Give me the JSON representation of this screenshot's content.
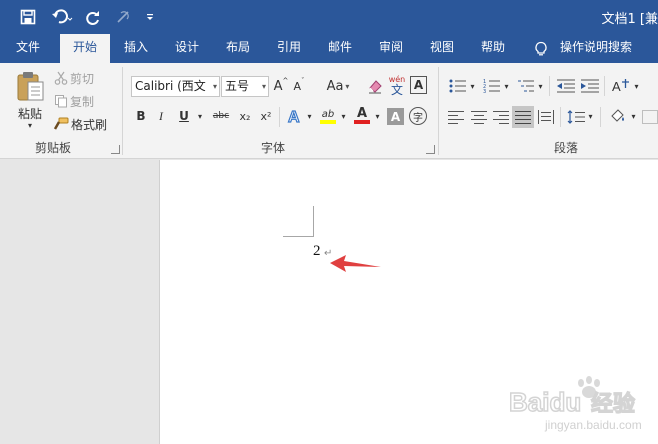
{
  "title_bar": {
    "doc_title": "文档1 [兼"
  },
  "tabs": [
    {
      "label": "文件"
    },
    {
      "label": "开始"
    },
    {
      "label": "插入"
    },
    {
      "label": "设计"
    },
    {
      "label": "布局"
    },
    {
      "label": "引用"
    },
    {
      "label": "邮件"
    },
    {
      "label": "审阅"
    },
    {
      "label": "视图"
    },
    {
      "label": "帮助"
    },
    {
      "label": "操作说明搜索"
    }
  ],
  "clipboard": {
    "paste": "粘贴",
    "cut": "剪切",
    "copy": "复制",
    "format_painter": "格式刷",
    "group_label": "剪贴板"
  },
  "font": {
    "font_name": "Calibri (西文",
    "font_size": "五号",
    "aa_label": "Aa",
    "pinyin_top": "wén",
    "pinyin_bottom": "文",
    "char_border": "A",
    "bold": "B",
    "italic": "I",
    "underline": "U",
    "strike": "abc",
    "subscript": "x₂",
    "superscript": "x²",
    "effect": "A",
    "highlight": "ab",
    "font_color": "A",
    "shading": "A",
    "enclose": "字",
    "group_label": "字体"
  },
  "paragraph": {
    "group_label": "段落"
  },
  "document": {
    "text": "2",
    "para_mark": "↵"
  },
  "colors": {
    "brand": "#2b579a",
    "highlight": "#ffff00",
    "font_color": "#e02020",
    "arrow": "#e04040"
  },
  "watermark": {
    "brand": "Baidu",
    "brand_cn": "经验",
    "url": "jingyan.baidu.com"
  }
}
